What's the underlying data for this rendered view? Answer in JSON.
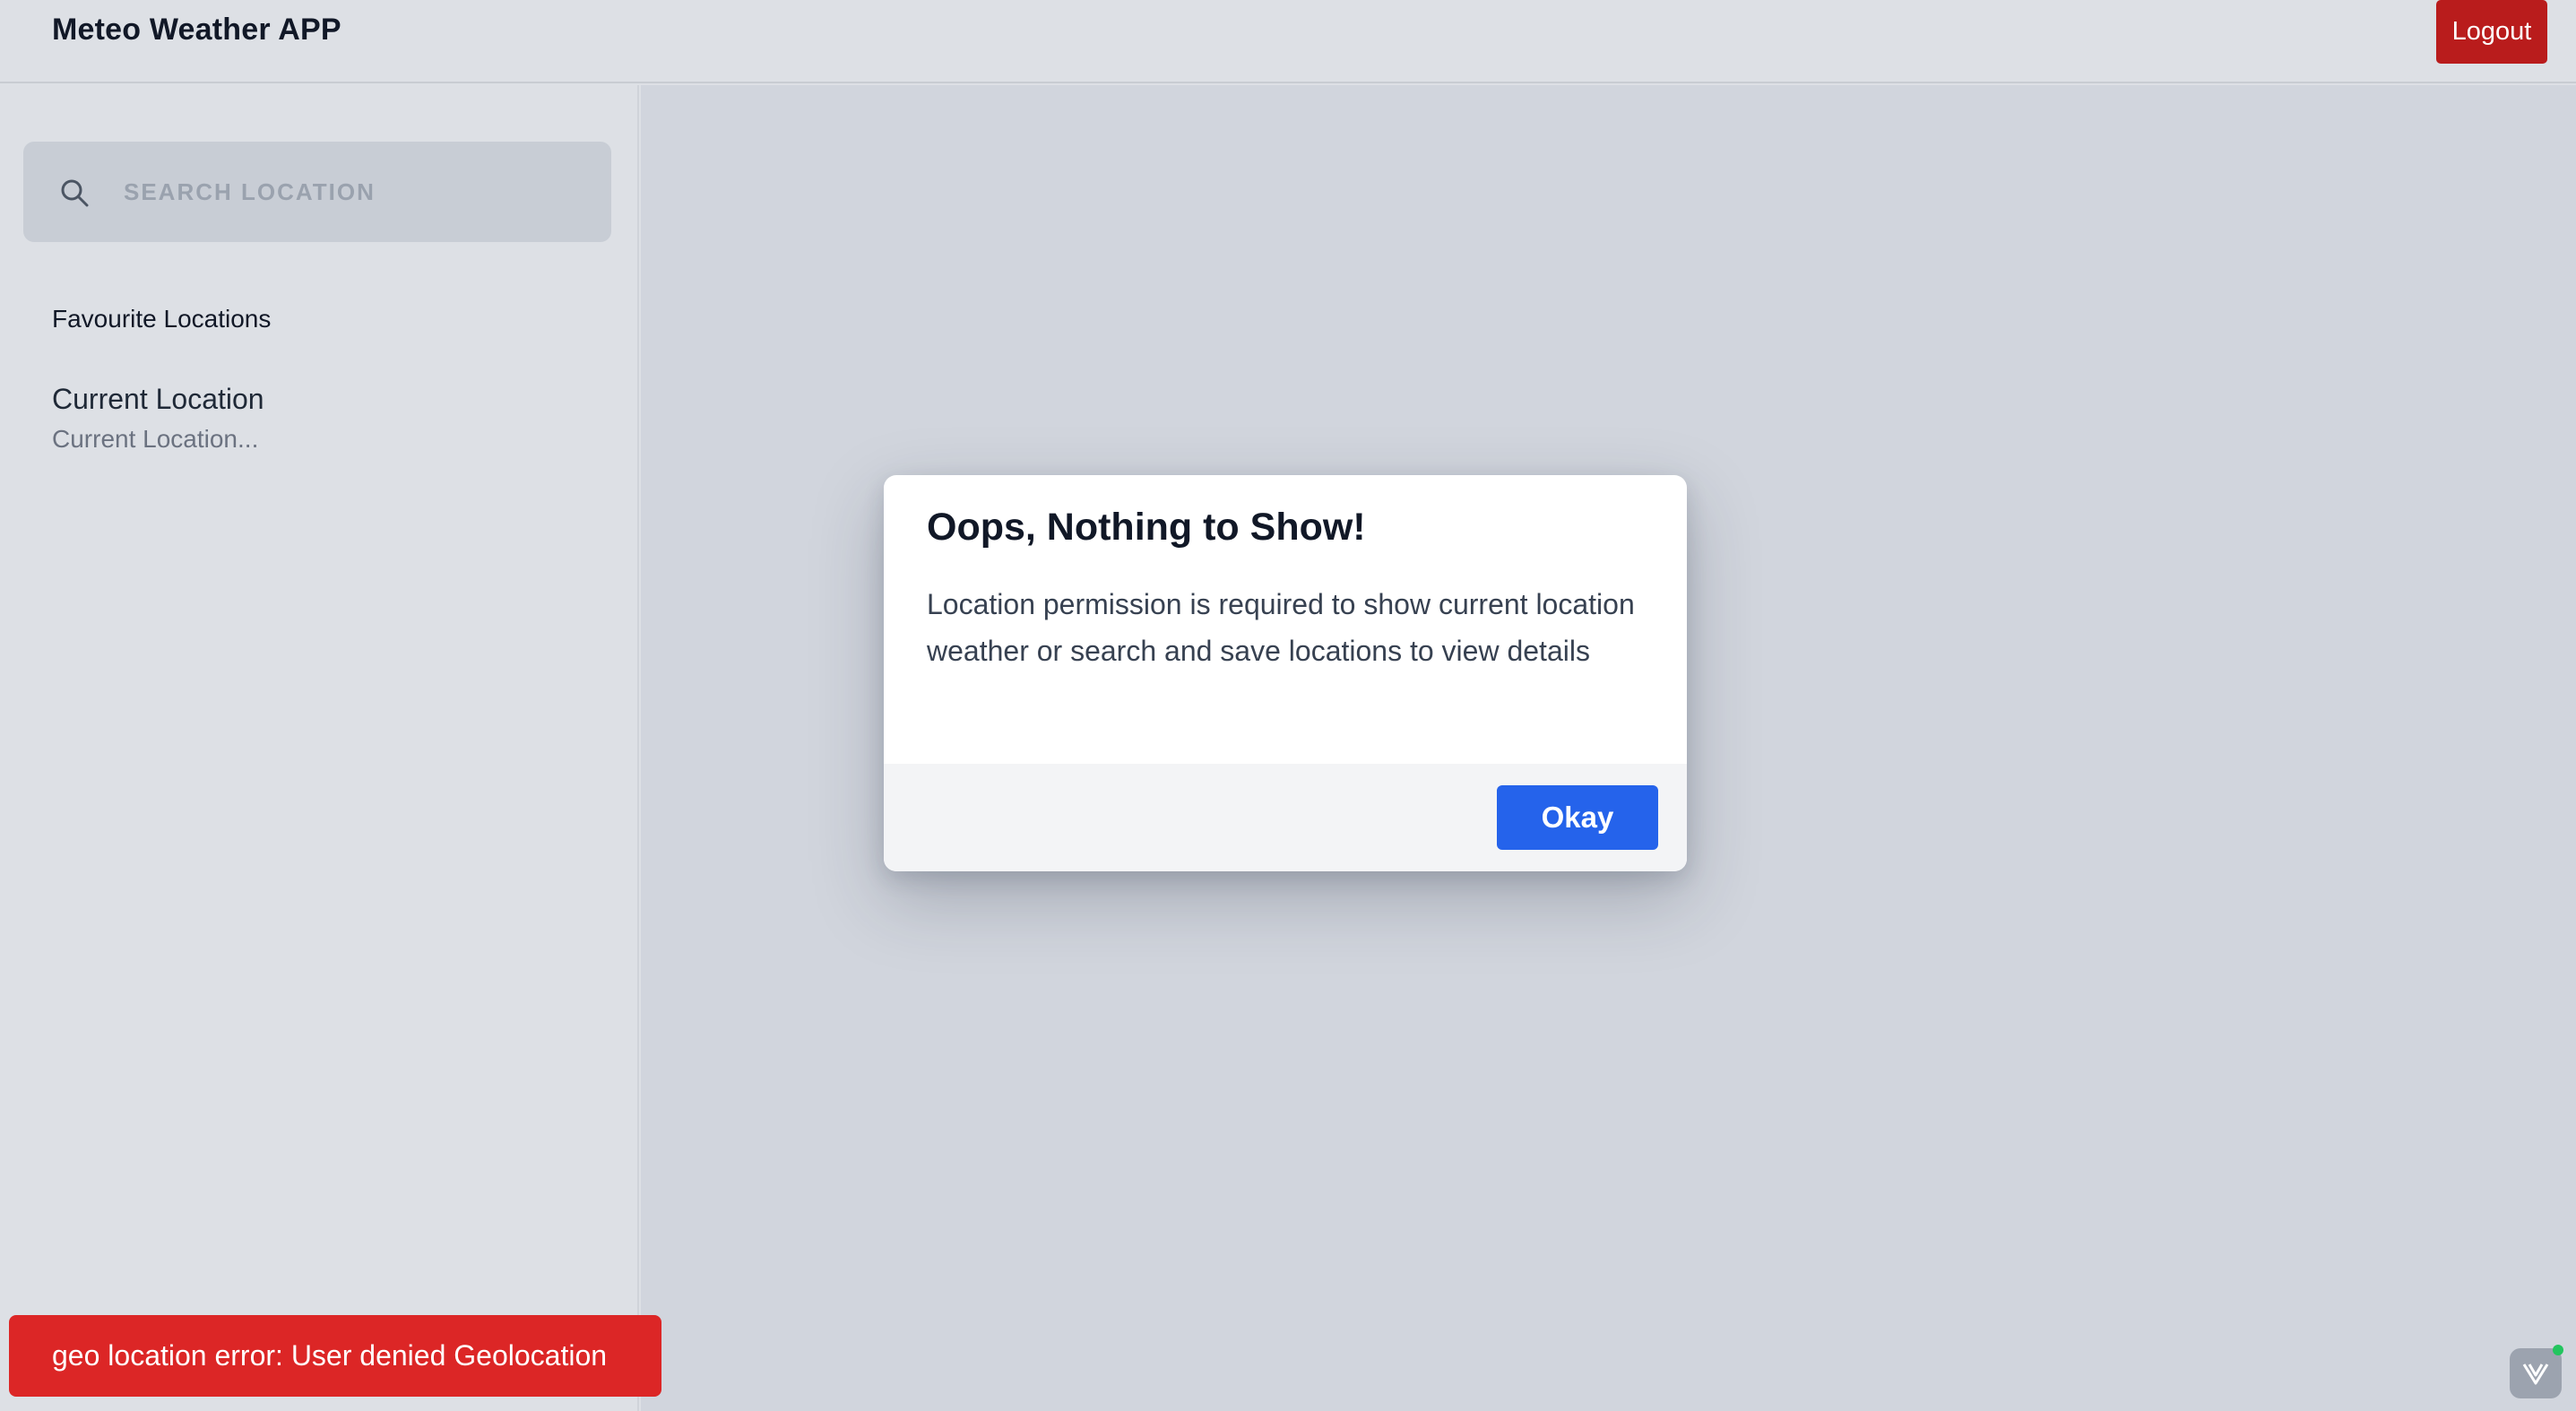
{
  "header": {
    "title": "Meteo Weather APP",
    "logout_label": "Logout"
  },
  "sidebar": {
    "search": {
      "placeholder": "SEARCH LOCATION",
      "value": "",
      "icon": "search-icon"
    },
    "favourites_heading": "Favourite Locations",
    "locations": [
      {
        "name": "Current Location",
        "subtitle": "Current Location..."
      }
    ]
  },
  "modal": {
    "title": "Oops, Nothing to Show!",
    "body": "Location permission is required to show current location weather or search and save locations to view details",
    "okay_label": "Okay"
  },
  "toast": {
    "message": "geo location error: User denied Geolocation",
    "color": "#dc2626"
  },
  "colors": {
    "logout": "#b91c1c",
    "primary_button": "#2563eb",
    "background": "#dde0e5"
  },
  "devtools": {
    "icon": "vue-devtools-icon",
    "status_dot_color": "#22c55e"
  }
}
